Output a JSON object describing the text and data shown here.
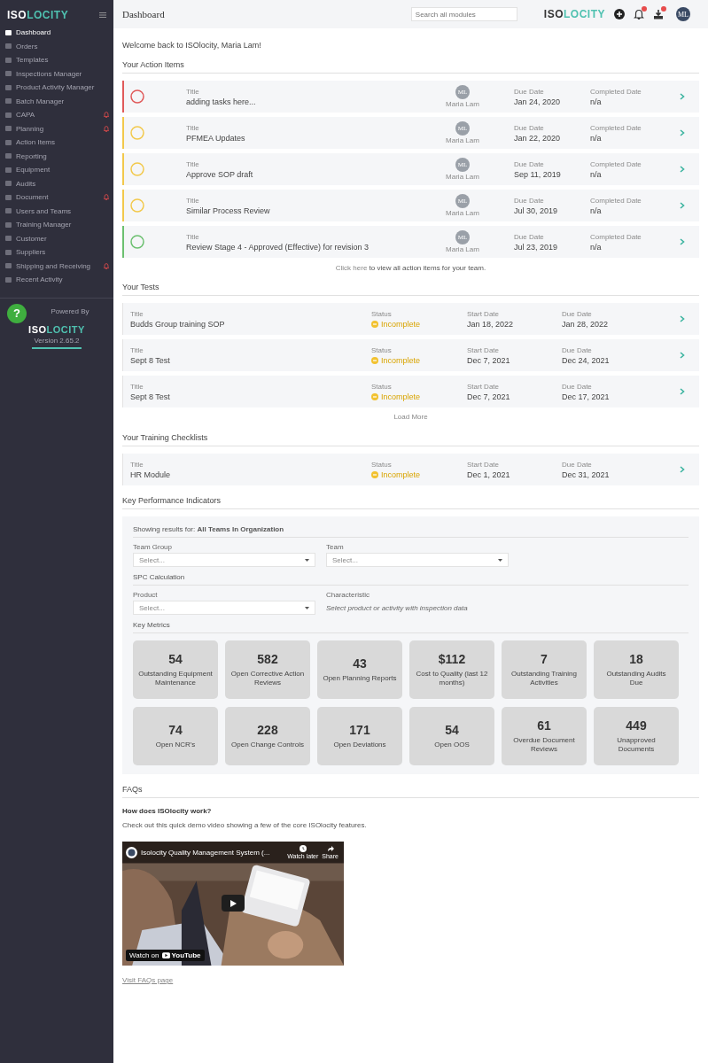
{
  "sidebar": {
    "logo": {
      "lead": "ISO",
      "rest": "LOCITY"
    },
    "items": [
      {
        "label": "Dashboard",
        "selected": true,
        "alert": false
      },
      {
        "label": "Orders",
        "selected": false,
        "alert": false
      },
      {
        "label": "Templates",
        "selected": false,
        "alert": false
      },
      {
        "label": "Inspections Manager",
        "selected": false,
        "alert": false
      },
      {
        "label": "Product Activity Manager",
        "selected": false,
        "alert": false
      },
      {
        "label": "Batch Manager",
        "selected": false,
        "alert": false
      },
      {
        "label": "CAPA",
        "selected": false,
        "alert": true
      },
      {
        "label": "Planning",
        "selected": false,
        "alert": true
      },
      {
        "label": "Action Items",
        "selected": false,
        "alert": false
      },
      {
        "label": "Reporting",
        "selected": false,
        "alert": false
      },
      {
        "label": "Equipment",
        "selected": false,
        "alert": false
      },
      {
        "label": "Audits",
        "selected": false,
        "alert": false
      },
      {
        "label": "Document",
        "selected": false,
        "alert": true
      },
      {
        "label": "Users and Teams",
        "selected": false,
        "alert": false
      },
      {
        "label": "Training Manager",
        "selected": false,
        "alert": false
      },
      {
        "label": "Customer",
        "selected": false,
        "alert": false
      },
      {
        "label": "Suppliers",
        "selected": false,
        "alert": false
      },
      {
        "label": "Shipping and Receiving",
        "selected": false,
        "alert": true
      },
      {
        "label": "Recent Activity",
        "selected": false,
        "alert": false
      }
    ],
    "footer": {
      "help_button": "?",
      "powered_by": "Powered By",
      "logo": {
        "lead": "ISO",
        "rest": "LOCITY"
      },
      "version": "Version 2.65.2"
    }
  },
  "header": {
    "title": "Dashboard",
    "search": {
      "placeholder": "Search all modules"
    },
    "logo": {
      "lead": "ISO",
      "rest": "LOCITY"
    },
    "avatar": "ML"
  },
  "welcome": "Welcome back to ISOlocity, Maria Lam!",
  "action_items": {
    "heading": "Your Action Items",
    "rows": [
      {
        "color": "#e05a5a",
        "title_label": "Title",
        "title": "adding tasks here...",
        "avatar": "ML",
        "assignee": "Maria Lam",
        "due_label": "Due Date",
        "due": "Jan 24, 2020",
        "completed_label": "Completed Date",
        "completed": "n/a"
      },
      {
        "color": "#f2c94c",
        "title_label": "Title",
        "title": "PFMEA Updates",
        "avatar": "ML",
        "assignee": "Maria Lam",
        "due_label": "Due Date",
        "due": "Jan 22, 2020",
        "completed_label": "Completed Date",
        "completed": "n/a"
      },
      {
        "color": "#f2c94c",
        "title_label": "Title",
        "title": "Approve SOP draft",
        "avatar": "ML",
        "assignee": "Maria Lam",
        "due_label": "Due Date",
        "due": "Sep 11, 2019",
        "completed_label": "Completed Date",
        "completed": "n/a"
      },
      {
        "color": "#f2c94c",
        "title_label": "Title",
        "title": "Similar Process Review",
        "avatar": "ML",
        "assignee": "Maria Lam",
        "due_label": "Due Date",
        "due": "Jul 30, 2019",
        "completed_label": "Completed Date",
        "completed": "n/a"
      },
      {
        "color": "#6cc070",
        "title_label": "Title",
        "title": "Review Stage 4 - Approved (Effective) for revision 3",
        "avatar": "ML",
        "assignee": "Maria Lam",
        "due_label": "Due Date",
        "due": "Jul 23, 2019",
        "completed_label": "Completed Date",
        "completed": "n/a"
      }
    ],
    "footer": {
      "link": "Click here",
      "text": "to view all action items for your team."
    }
  },
  "tests": {
    "heading": "Your Tests",
    "rows": [
      {
        "title_label": "Title",
        "title": "Budds Group training SOP",
        "status_label": "Status",
        "status": "Incomplete",
        "start_label": "Start Date",
        "start": "Jan 18, 2022",
        "due_label": "Due Date",
        "due": "Jan 28, 2022"
      },
      {
        "title_label": "Title",
        "title": "Sept 8 Test",
        "status_label": "Status",
        "status": "Incomplete",
        "start_label": "Start Date",
        "start": "Dec 7, 2021",
        "due_label": "Due Date",
        "due": "Dec 24, 2021"
      },
      {
        "title_label": "Title",
        "title": "Sept 8 Test",
        "status_label": "Status",
        "status": "Incomplete",
        "start_label": "Start Date",
        "start": "Dec 7, 2021",
        "due_label": "Due Date",
        "due": "Dec 17, 2021"
      }
    ],
    "load_more": "Load More"
  },
  "training_checklists": {
    "heading": "Your Training Checklists",
    "rows": [
      {
        "title_label": "Title",
        "title": "HR Module",
        "status_label": "Status",
        "status": "Incomplete",
        "start_label": "Start Date",
        "start": "Dec 1, 2021",
        "due_label": "Due Date",
        "due": "Dec 31, 2021"
      }
    ]
  },
  "kpi": {
    "heading": "Key Performance Indicators",
    "showing": "Showing results for: **All Teams In Organization**",
    "filters": [
      {
        "label": "Team Group",
        "placeholder": "Select..."
      },
      {
        "label": "Team",
        "placeholder": "Select..."
      }
    ],
    "spc_heading": "SPC Calculation",
    "product": {
      "label": "Product",
      "placeholder": "Select..."
    },
    "characteristic": {
      "label": "Characteristic",
      "hint": "Select product or activity with inspection data"
    },
    "metrics_heading": "Key Metrics",
    "metrics": [
      {
        "value": "54",
        "label": "Outstanding Equipment Maintenance"
      },
      {
        "value": "582",
        "label": "Open Corrective Action Reviews"
      },
      {
        "value": "43",
        "label": "Open Planning Reports"
      },
      {
        "value": "$112",
        "label": "Cost to Quality (last 12 months)"
      },
      {
        "value": "7",
        "label": "Outstanding Training Activities"
      },
      {
        "value": "18",
        "label": "Outstanding Audits Due"
      },
      {
        "value": "74",
        "label": "Open NCR's"
      },
      {
        "value": "228",
        "label": "Open Change Controls"
      },
      {
        "value": "171",
        "label": "Open Deviations"
      },
      {
        "value": "54",
        "label": "Open OOS"
      },
      {
        "value": "61",
        "label": "Overdue Document Reviews"
      },
      {
        "value": "449",
        "label": "Unapproved Documents"
      }
    ]
  },
  "faqs": {
    "heading": "FAQs",
    "question": "How does ISOlocity work?",
    "text": "Check out this quick demo video showing a few of the core ISOlocity features.",
    "video": {
      "kind": "picture",
      "title": "Isolocity Quality Management System (...",
      "watch_later": "Watch later",
      "share": "Share",
      "watch_on": "Watch on",
      "brand": "YouTube"
    },
    "link": "Visit FAQs page"
  }
}
